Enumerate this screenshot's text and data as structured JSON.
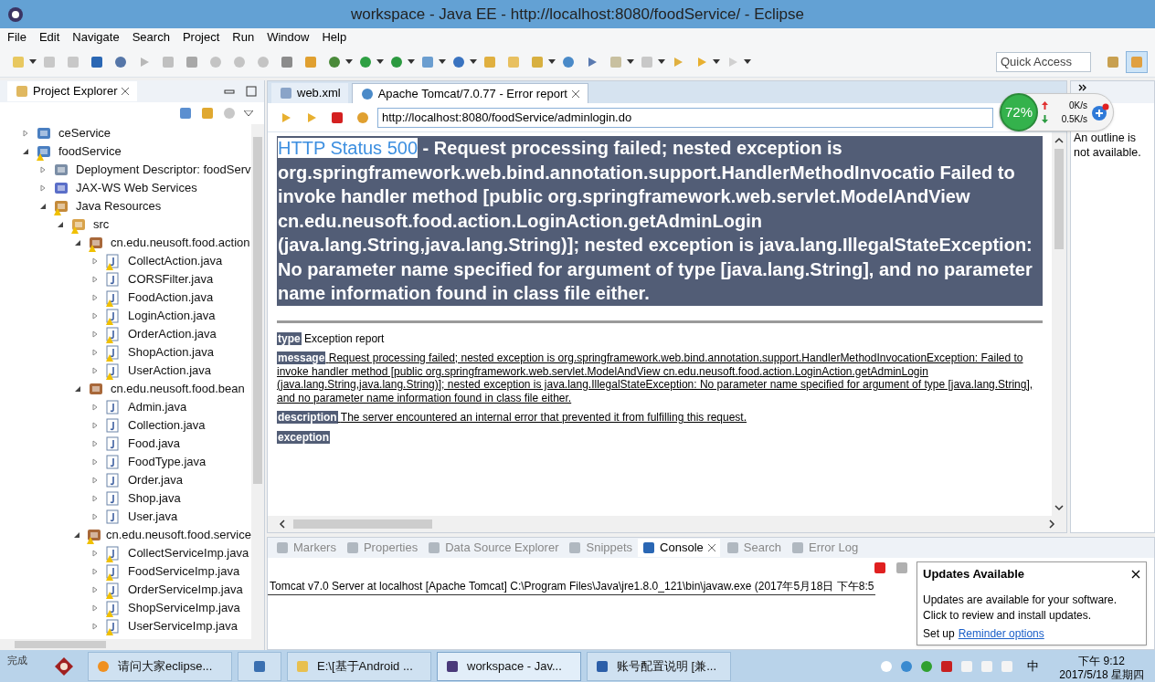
{
  "window": {
    "title": "workspace - Java EE - http://localhost:8080/foodService/ - Eclipse"
  },
  "menu": [
    "File",
    "Edit",
    "Navigate",
    "Search",
    "Project",
    "Run",
    "Window",
    "Help"
  ],
  "quick_access": {
    "placeholder": "Quick Access"
  },
  "project_explorer": {
    "title": "Project Explorer",
    "tree": [
      {
        "label": "ceService",
        "kind": "project",
        "expanded": false,
        "warning": false
      },
      {
        "label": "foodService",
        "kind": "project",
        "expanded": true,
        "warning": true,
        "children": [
          {
            "label": "Deployment Descriptor: foodServ",
            "kind": "descriptor",
            "expanded": false,
            "warning": false
          },
          {
            "label": "JAX-WS Web Services",
            "kind": "webservice",
            "expanded": false,
            "warning": false
          },
          {
            "label": "Java Resources",
            "kind": "resources",
            "expanded": true,
            "warning": true,
            "children": [
              {
                "label": "src",
                "kind": "src",
                "expanded": true,
                "warning": true,
                "children": [
                  {
                    "label": "cn.edu.neusoft.food.action",
                    "kind": "package",
                    "expanded": true,
                    "warning": true,
                    "children": [
                      {
                        "label": "CollectAction.java",
                        "kind": "java",
                        "expanded": false,
                        "warning": true
                      },
                      {
                        "label": "CORSFilter.java",
                        "kind": "java",
                        "expanded": false,
                        "warning": false
                      },
                      {
                        "label": "FoodAction.java",
                        "kind": "java",
                        "expanded": false,
                        "warning": true
                      },
                      {
                        "label": "LoginAction.java",
                        "kind": "java",
                        "expanded": false,
                        "warning": true
                      },
                      {
                        "label": "OrderAction.java",
                        "kind": "java",
                        "expanded": false,
                        "warning": true
                      },
                      {
                        "label": "ShopAction.java",
                        "kind": "java",
                        "expanded": false,
                        "warning": true
                      },
                      {
                        "label": "UserAction.java",
                        "kind": "java",
                        "expanded": false,
                        "warning": true
                      }
                    ]
                  },
                  {
                    "label": "cn.edu.neusoft.food.bean",
                    "kind": "package",
                    "expanded": true,
                    "warning": false,
                    "children": [
                      {
                        "label": "Admin.java",
                        "kind": "java",
                        "expanded": false,
                        "warning": false
                      },
                      {
                        "label": "Collection.java",
                        "kind": "java",
                        "expanded": false,
                        "warning": false
                      },
                      {
                        "label": "Food.java",
                        "kind": "java",
                        "expanded": false,
                        "warning": false
                      },
                      {
                        "label": "FoodType.java",
                        "kind": "java",
                        "expanded": false,
                        "warning": false
                      },
                      {
                        "label": "Order.java",
                        "kind": "java",
                        "expanded": false,
                        "warning": false
                      },
                      {
                        "label": "Shop.java",
                        "kind": "java",
                        "expanded": false,
                        "warning": false
                      },
                      {
                        "label": "User.java",
                        "kind": "java",
                        "expanded": false,
                        "warning": false
                      }
                    ]
                  },
                  {
                    "label": "cn.edu.neusoft.food.service",
                    "kind": "package",
                    "expanded": true,
                    "warning": true,
                    "children": [
                      {
                        "label": "CollectServiceImp.java",
                        "kind": "java",
                        "expanded": false,
                        "warning": true
                      },
                      {
                        "label": "FoodServiceImp.java",
                        "kind": "java",
                        "expanded": false,
                        "warning": true
                      },
                      {
                        "label": "OrderServiceImp.java",
                        "kind": "java",
                        "expanded": false,
                        "warning": true
                      },
                      {
                        "label": "ShopServiceImp.java",
                        "kind": "java",
                        "expanded": false,
                        "warning": true
                      },
                      {
                        "label": "UserServiceImp.java",
                        "kind": "java",
                        "expanded": false,
                        "warning": true
                      }
                    ]
                  }
                ]
              }
            ]
          }
        ]
      }
    ]
  },
  "editor": {
    "tabs": [
      {
        "label": "web.xml",
        "selected": false
      },
      {
        "label": "Apache Tomcat/7.0.77 - Error report",
        "selected": true
      }
    ],
    "url": "http://localhost:8080/foodService/adminlogin.do",
    "page": {
      "status": "HTTP Status 500",
      "heading": "- Request processing failed; nested exception is org.springframework.web.bind.annotation.support.HandlerMethodInvocatio Failed to invoke handler method [public org.springframework.web.servlet.ModelAndView cn.edu.neusoft.food.action.LoginAction.getAdminLogin (java.lang.String,java.lang.String)]; nested exception is java.lang.IllegalStateException: No parameter name specified for argument of type [java.lang.String], and no parameter name information found in class file either.",
      "sections": [
        {
          "label": "type",
          "text": "Exception report",
          "underlined": false
        },
        {
          "label": "message",
          "text": "Request processing failed; nested exception is org.springframework.web.bind.annotation.support.HandlerMethodInvocationException: Failed to invoke handler method [public org.springframework.web.servlet.ModelAndView cn.edu.neusoft.food.action.LoginAction.getAdminLogin (java.lang.String,java.lang.String)]; nested exception is java.lang.IllegalStateException: No parameter name specified for argument of type [java.lang.String], and no parameter name information found in class file either.",
          "underlined": true
        },
        {
          "label": "description",
          "text": "The server encountered an internal error that prevented it from fulfilling this request.",
          "underlined": true
        },
        {
          "label": "exception"
        }
      ]
    }
  },
  "outline": {
    "message": "An outline is not available."
  },
  "net_monitor": {
    "percent": "72%",
    "upload": "0K/s",
    "download": "0.5K/s"
  },
  "bottom_tabs": [
    {
      "label": "Markers",
      "selected": false
    },
    {
      "label": "Properties",
      "selected": false
    },
    {
      "label": "Data Source Explorer",
      "selected": false
    },
    {
      "label": "Snippets",
      "selected": false
    },
    {
      "label": "Console",
      "selected": true
    },
    {
      "label": "Search",
      "selected": false
    },
    {
      "label": "Error Log",
      "selected": false
    }
  ],
  "console": {
    "text": "Tomcat v7.0 Server at localhost [Apache Tomcat] C:\\Program Files\\Java\\jre1.8.0_121\\bin\\javaw.exe (2017年5月18日 下午8:5"
  },
  "updates_popup": {
    "title": "Updates Available",
    "message": "Updates are available for your software. Click to review and install updates.",
    "setup": "Set up",
    "link": "Reminder options"
  },
  "status_text": "完成",
  "taskbar": {
    "items": [
      {
        "kind": "browser",
        "label": "请问大家eclipse...",
        "selected": false
      },
      {
        "kind": "python",
        "selected": false
      },
      {
        "kind": "folder",
        "label": "E:\\[基于Android ...",
        "selected": false
      },
      {
        "kind": "eclipse",
        "label": "workspace - Jav...",
        "selected": true
      },
      {
        "kind": "word",
        "label": "账号配置说明 [兼...",
        "selected": false
      }
    ],
    "ime": "中",
    "time": "下午 9:12",
    "date": "2017/5/18 星期四"
  }
}
